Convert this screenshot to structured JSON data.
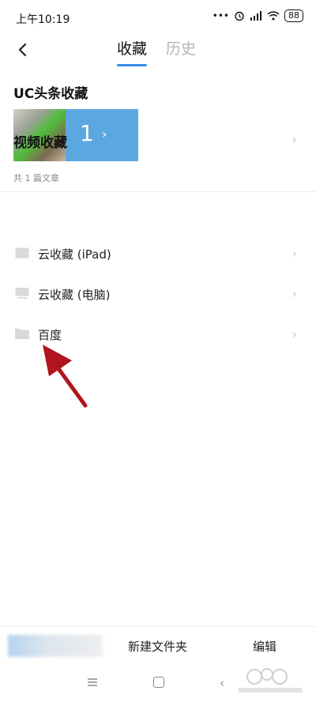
{
  "status": {
    "time": "上午10:19",
    "dots": "•••",
    "battery": "88"
  },
  "tabs": [
    {
      "label": "收藏"
    },
    {
      "label": "历史"
    }
  ],
  "uc": {
    "title": "UC头条收藏",
    "count": "1",
    "chevron": "›",
    "summary": "共 1 篇文章"
  },
  "video": {
    "title": "视频收藏",
    "chevron": "›"
  },
  "folders": [
    {
      "label": "云收藏 (iPad)",
      "icon": "tablet-icon"
    },
    {
      "label": "云收藏 (电脑)",
      "icon": "monitor-icon"
    },
    {
      "label": "百度",
      "icon": "folder-icon"
    }
  ],
  "folder_chevron": "›",
  "bottom": {
    "new_folder": "新建文件夹",
    "edit": "编辑"
  },
  "nav": {
    "back": "‹"
  },
  "colors": {
    "accent": "#3a8ee8",
    "card": "#5ba8e1",
    "annotation": "#b0141c"
  }
}
